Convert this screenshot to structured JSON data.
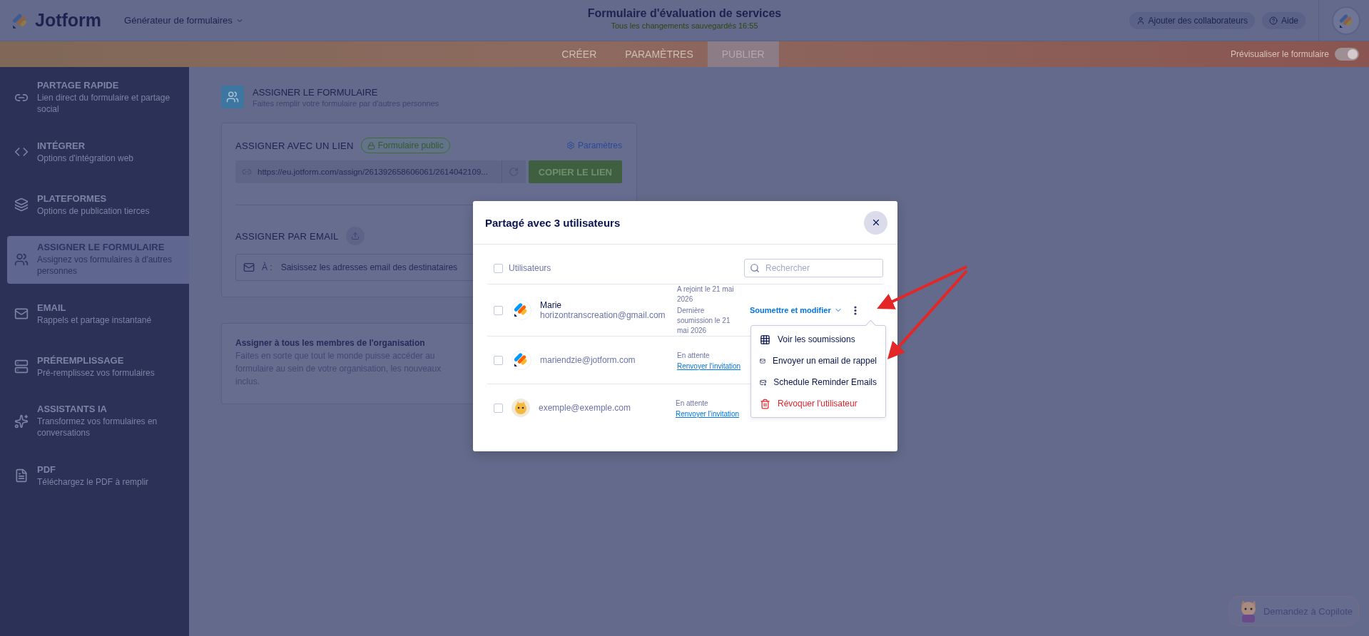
{
  "header": {
    "logo": "Jotform",
    "builder_menu": "Générateur de formulaires",
    "form_title": "Formulaire d'évaluation de services",
    "save_status": "Tous les changements sauvegardés 16:55",
    "collaborators_button": "Ajouter des collaborateurs",
    "help_button": "Aide"
  },
  "nav_tabs": [
    {
      "label": "CRÉER",
      "selected": false
    },
    {
      "label": "PARAMÈTRES",
      "selected": false
    },
    {
      "label": "PUBLIER",
      "selected": true
    }
  ],
  "preview_toggle": {
    "label": "Prévisualiser le formulaire",
    "on": true
  },
  "sidebar": {
    "items": [
      {
        "title": "PARTAGE RAPIDE",
        "subtitle": "Lien direct du formulaire et partage social",
        "selected": false
      },
      {
        "title": "INTÉGRER",
        "subtitle": "Options d'intégration web",
        "selected": false
      },
      {
        "title": "PLATEFORMES",
        "subtitle": "Options de publication tierces",
        "selected": false
      },
      {
        "title": "ASSIGNER LE FORMULAIRE",
        "subtitle": "Assignez vos formulaires à d'autres personnes",
        "selected": true
      },
      {
        "title": "EMAIL",
        "subtitle": "Rappels et partage instantané",
        "selected": false
      },
      {
        "title": "PRÉREMPLISSAGE",
        "subtitle": "Pré-remplissez vos formulaires",
        "selected": false
      },
      {
        "title": "ASSISTANTS IA",
        "subtitle": "Transformez vos formulaires en conversations",
        "selected": false
      },
      {
        "title": "PDF",
        "subtitle": "Téléchargez le PDF à remplir",
        "selected": false
      }
    ]
  },
  "page_header": {
    "title": "ASSIGNER LE FORMULAIRE",
    "subtitle": "Faites remplir votre formulaire par d'autres personnes"
  },
  "link_section": {
    "title": "ASSIGNER AVEC UN LIEN",
    "badge": "Formulaire public",
    "settings_link": "Paramètres",
    "url": "https://eu.jotform.com/assign/261392658606061/2614042109...",
    "copy_button": "COPIER LE LIEN"
  },
  "email_section": {
    "title": "ASSIGNER PAR EMAIL",
    "to_label": "À :",
    "placeholder": "Saisissez les adresses email des destinataires"
  },
  "org_section": {
    "title": "Assigner à tous les membres de l'organisation",
    "text": "Faites en sorte que tout le monde puisse accéder au formulaire au sein de votre organisation, les nouveaux inclus."
  },
  "modal": {
    "title": "Partagé avec 3 utilisateurs",
    "select_all": {
      "label": "Utilisateurs",
      "checked": false
    },
    "search_placeholder": "Rechercher",
    "users": [
      {
        "name": "Marie",
        "email": "horizontranscreation@gmail.com",
        "status": [
          "A rejoint le 21 mai 2026",
          "Dernière soumission le 21 mai 2026"
        ],
        "permission": "Soumettre et modifier",
        "checked": false
      },
      {
        "email": "mariendzie@jotform.com",
        "status": [
          "En attente"
        ],
        "resend_link": "Renvoyer l'invitation",
        "checked": false
      },
      {
        "email": "exemple@exemple.com",
        "status": [
          "En attente"
        ],
        "resend_link": "Renvoyer l'invitation",
        "checked": false
      }
    ],
    "menu": [
      {
        "kind": "grid",
        "label": "Voir les soumissions"
      },
      {
        "kind": "mail",
        "label": "Envoyer un email de rappel"
      },
      {
        "kind": "schedule",
        "label": "Schedule Reminder Emails"
      },
      {
        "kind": "danger",
        "label": "Révoquer l'utilisateur"
      }
    ]
  },
  "copilot_button": "Demandez à Copilote"
}
